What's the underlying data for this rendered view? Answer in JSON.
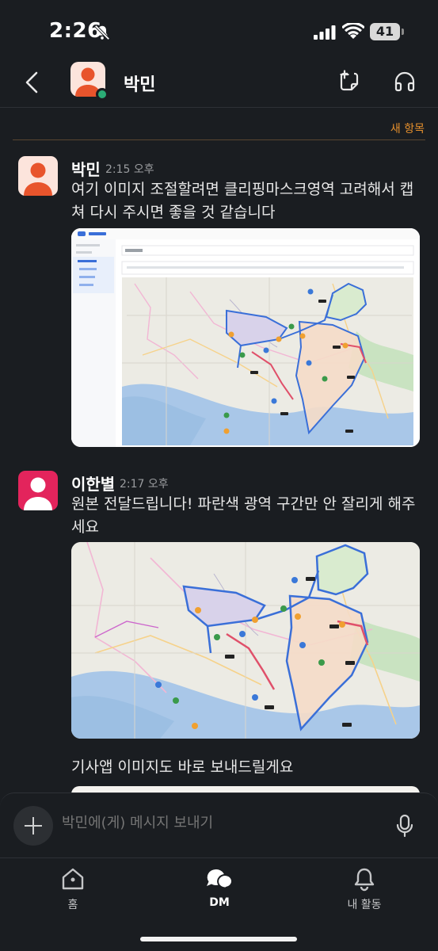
{
  "status_bar": {
    "time": "2:26",
    "battery": "41"
  },
  "header": {
    "name": "박민",
    "canvas_icon": "canvas-add-icon",
    "huddle_icon": "headphones-icon"
  },
  "divider": {
    "label": "새 항목"
  },
  "messages": [
    {
      "sender": "박민",
      "time": "2:15 오후",
      "text": "여기 이미지 조절할려면 클리핑마스크영역 고려해서 캡쳐 다시 주시면 좋을 것 같습니다",
      "avatar_color": "#e8542c"
    },
    {
      "sender": "이한별",
      "time": "2:17 오후",
      "text": "원본 전달드립니다! 파란색 광역 구간만 안 잘리게 해주세요",
      "followup": "기사앱 이미지도 바로 보내드릴게요",
      "avatar_color": "#e3245c"
    }
  ],
  "composer": {
    "placeholder": "박민에(게) 메시지 보내기"
  },
  "tabs": [
    {
      "label": "홈",
      "icon": "home-icon"
    },
    {
      "label": "DM",
      "icon": "dm-icon"
    },
    {
      "label": "내 활동",
      "icon": "bell-icon"
    }
  ],
  "colors": {
    "background": "#1a1d21",
    "accent_new": "#e8912d",
    "route_blue": "#3a6fd8",
    "presence": "#2bac76"
  }
}
